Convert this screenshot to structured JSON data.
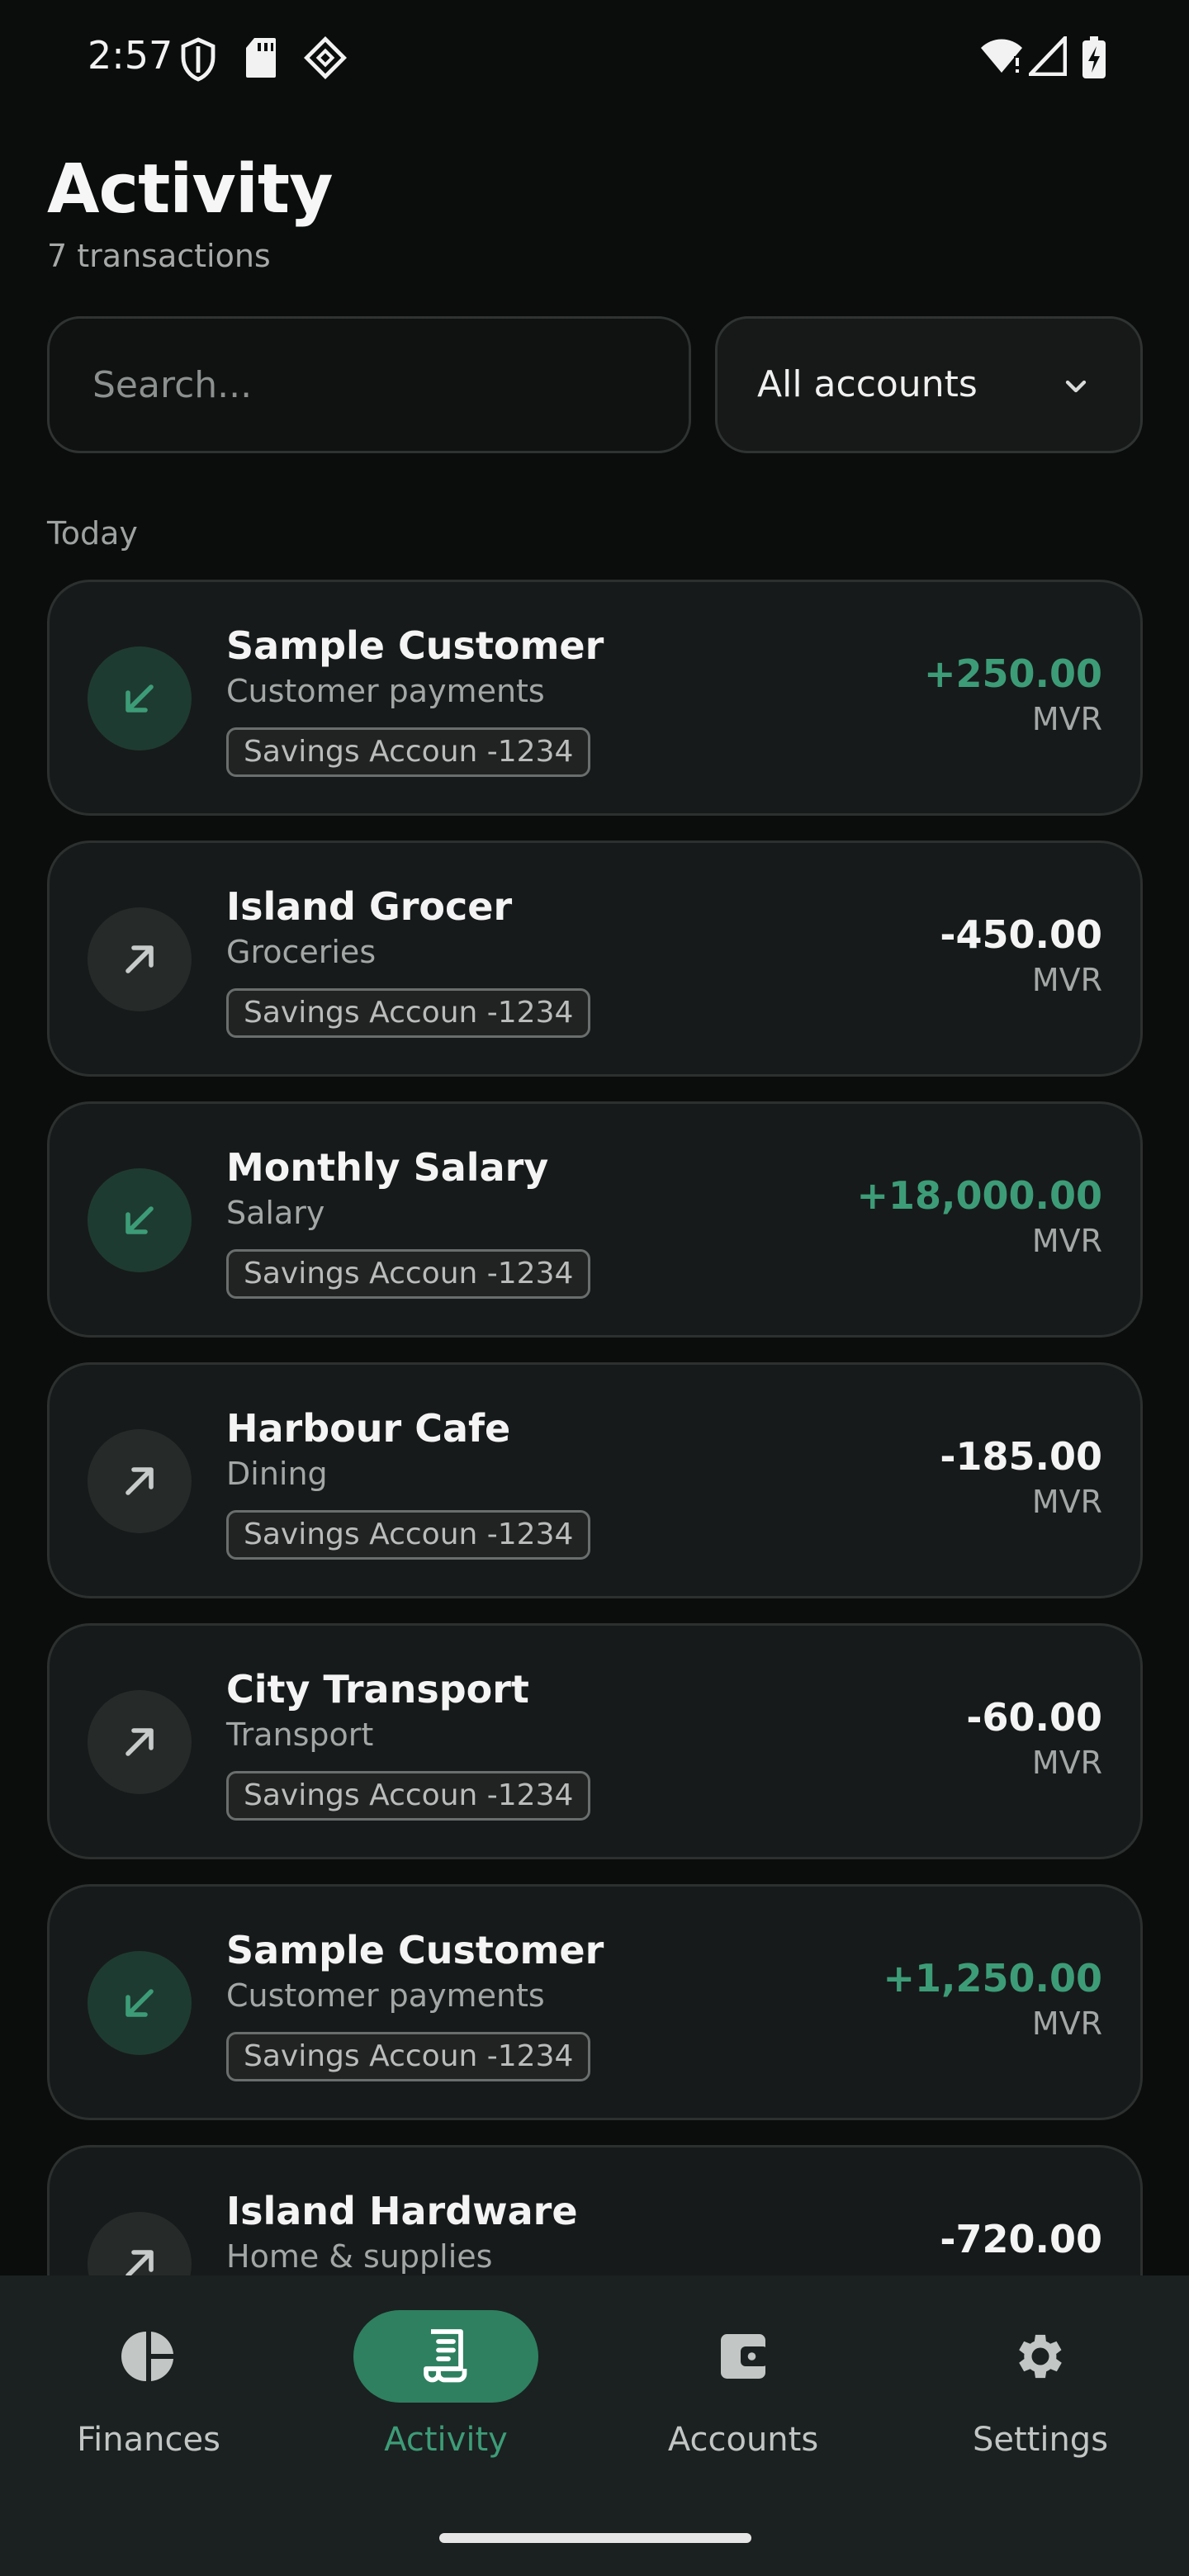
{
  "status_bar": {
    "time": "2:57",
    "left_icons": [
      "shield-icon",
      "sd-card-icon",
      "app-badge-icon"
    ],
    "right_icons": [
      "wifi-alert-icon",
      "cellular-signal-icon",
      "battery-charging-icon"
    ]
  },
  "header": {
    "title": "Activity",
    "subtitle": "7 transactions"
  },
  "filters": {
    "search_placeholder": "Search...",
    "search_value": "",
    "account_select": "All accounts"
  },
  "sections": [
    {
      "label": "Today"
    }
  ],
  "transactions": [
    {
      "name": "Sample Customer",
      "category": "Customer payments",
      "account": "Savings Accoun -1234",
      "amount": "+250.00",
      "currency": "MVR",
      "direction": "in"
    },
    {
      "name": "Island Grocer",
      "category": "Groceries",
      "account": "Savings Accoun -1234",
      "amount": "-450.00",
      "currency": "MVR",
      "direction": "out"
    },
    {
      "name": "Monthly Salary",
      "category": "Salary",
      "account": "Savings Accoun -1234",
      "amount": "+18,000.00",
      "currency": "MVR",
      "direction": "in"
    },
    {
      "name": "Harbour Cafe",
      "category": "Dining",
      "account": "Savings Accoun -1234",
      "amount": "-185.00",
      "currency": "MVR",
      "direction": "out"
    },
    {
      "name": "City Transport",
      "category": "Transport",
      "account": "Savings Accoun -1234",
      "amount": "-60.00",
      "currency": "MVR",
      "direction": "out"
    },
    {
      "name": "Sample Customer",
      "category": "Customer payments",
      "account": "Savings Accoun -1234",
      "amount": "+1,250.00",
      "currency": "MVR",
      "direction": "in"
    },
    {
      "name": "Island Hardware",
      "category": "Home & supplies",
      "account": "",
      "amount": "-720.00",
      "currency": "",
      "direction": "out"
    }
  ],
  "bottom_nav": {
    "items": [
      {
        "label": "Finances",
        "icon": "pie-chart-icon",
        "active": false
      },
      {
        "label": "Activity",
        "icon": "receipt-icon",
        "active": true
      },
      {
        "label": "Accounts",
        "icon": "wallet-icon",
        "active": false
      },
      {
        "label": "Settings",
        "icon": "gear-icon",
        "active": false
      }
    ]
  },
  "colors": {
    "background": "#0b0c0c",
    "card": "#171a1a",
    "income": "#3d9c78",
    "accent": "#2e8060"
  }
}
